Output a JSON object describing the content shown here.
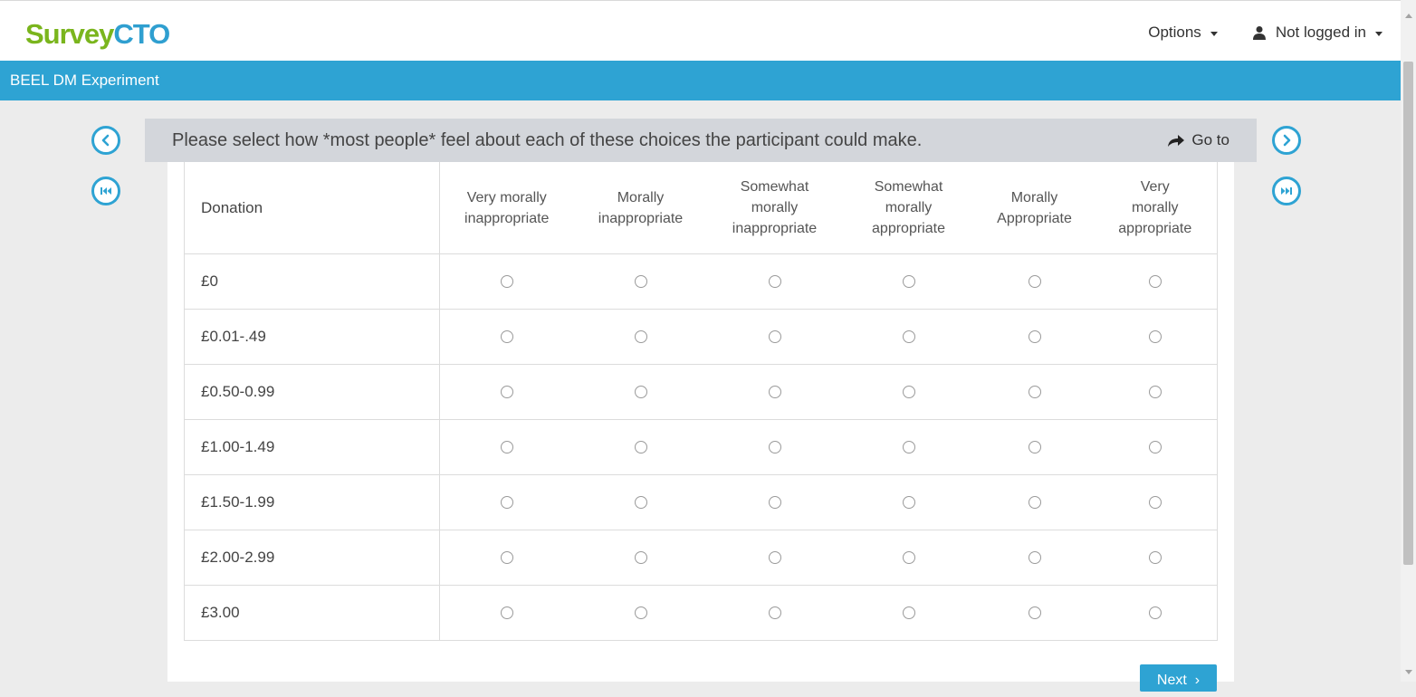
{
  "header": {
    "logo_part1": "Survey",
    "logo_part2": "CTO",
    "options_label": "Options",
    "user_label": "Not logged in"
  },
  "form": {
    "title": "BEEL DM Experiment"
  },
  "question": {
    "text": "Please select how *most people* feel about each of these choices the participant could make.",
    "goto_label": "Go to"
  },
  "grid": {
    "row_header": "Donation",
    "columns": [
      [
        "Very morally",
        "inappropriate"
      ],
      [
        "Morally",
        "inappropriate"
      ],
      [
        "Somewhat",
        "morally",
        "inappropriate"
      ],
      [
        "Somewhat",
        "morally",
        "appropriate"
      ],
      [
        "Morally",
        "Appropriate"
      ],
      [
        "Very",
        "morally",
        "appropriate"
      ]
    ],
    "rows": [
      "£0",
      "£0.01-.49",
      "£0.50-0.99",
      "£1.00-1.49",
      "£1.50-1.99",
      "£2.00-2.99",
      "£3.00"
    ]
  },
  "footer": {
    "next_label": "Next"
  },
  "colors": {
    "accent": "#2ea3d3",
    "logo_green": "#7ab51d",
    "question_bar": "#d3d6db"
  },
  "icons": {
    "prev": "chevron-left-icon",
    "first": "skip-first-icon",
    "next": "chevron-right-icon",
    "last": "skip-last-icon",
    "goto": "share-arrow-icon",
    "user": "user-icon"
  }
}
